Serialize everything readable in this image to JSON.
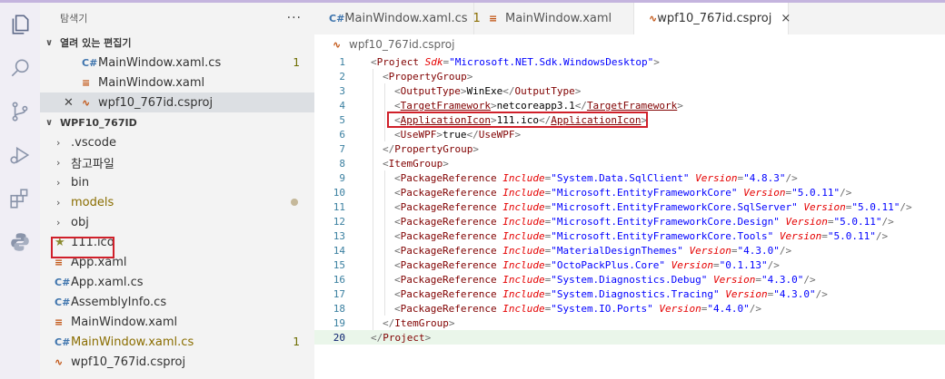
{
  "activity_bar": {
    "icons": [
      "files-icon",
      "search-icon",
      "source-control-icon",
      "run-debug-icon",
      "extensions-icon",
      "python-icon"
    ]
  },
  "sidebar": {
    "title": "탐색기",
    "more_label": "···",
    "open_editors": {
      "header": "열려 있는 편집기",
      "items": [
        {
          "name": "MainWindow.xaml.cs",
          "type": "cs",
          "badge": "1"
        },
        {
          "name": "MainWindow.xaml",
          "type": "xaml",
          "badge": ""
        },
        {
          "name": "wpf10_767id.csproj",
          "type": "csproj",
          "badge": "",
          "selected": true
        }
      ]
    },
    "project": {
      "header": "WPF10_767ID",
      "folders": [
        {
          "name": ".vscode",
          "dot": false
        },
        {
          "name": "참고파일",
          "dot": false
        },
        {
          "name": "bin",
          "dot": false
        },
        {
          "name": "models",
          "dot": true
        },
        {
          "name": "obj",
          "dot": false
        }
      ],
      "files": [
        {
          "name": "111.ico",
          "type": "ico",
          "badge": ""
        },
        {
          "name": "App.xaml",
          "type": "xaml",
          "badge": ""
        },
        {
          "name": "App.xaml.cs",
          "type": "cs",
          "badge": ""
        },
        {
          "name": "AssemblyInfo.cs",
          "type": "cs",
          "badge": ""
        },
        {
          "name": "MainWindow.xaml",
          "type": "xaml",
          "badge": ""
        },
        {
          "name": "MainWindow.xaml.cs",
          "type": "cs",
          "badge": "1"
        },
        {
          "name": "wpf10_767id.csproj",
          "type": "csproj",
          "badge": ""
        }
      ]
    }
  },
  "tabs": [
    {
      "label": "MainWindow.xaml.cs",
      "type": "cs",
      "badge": "1",
      "active": false
    },
    {
      "label": "MainWindow.xaml",
      "type": "xaml",
      "badge": "",
      "active": false
    },
    {
      "label": "wpf10_767id.csproj",
      "type": "csproj",
      "badge": "",
      "active": true,
      "close": "×"
    }
  ],
  "breadcrumb": "wpf10_767id.csproj",
  "code_lines": [
    {
      "n": "1",
      "indent": 0,
      "parts": [
        [
          "brk",
          "<"
        ],
        [
          "tag",
          "Project"
        ],
        [
          "txt",
          " "
        ],
        [
          "attr",
          "Sdk"
        ],
        [
          "brk",
          "="
        ],
        [
          "val",
          "\"Microsoft.NET.Sdk.WindowsDesktop\""
        ],
        [
          "brk",
          ">"
        ]
      ]
    },
    {
      "n": "2",
      "indent": 1,
      "parts": [
        [
          "brk",
          "<"
        ],
        [
          "tag",
          "PropertyGroup"
        ],
        [
          "brk",
          ">"
        ]
      ]
    },
    {
      "n": "3",
      "indent": 2,
      "parts": [
        [
          "brk",
          "<"
        ],
        [
          "tag",
          "OutputType"
        ],
        [
          "brk",
          ">"
        ],
        [
          "txt",
          "WinExe"
        ],
        [
          "brk",
          "</"
        ],
        [
          "tag",
          "OutputType"
        ],
        [
          "brk",
          ">"
        ]
      ]
    },
    {
      "n": "4",
      "indent": 2,
      "parts": [
        [
          "brk",
          "<"
        ],
        [
          "tagu",
          "TargetFramework"
        ],
        [
          "brk",
          ">"
        ],
        [
          "txt",
          "netcoreapp3.1"
        ],
        [
          "brk",
          "</"
        ],
        [
          "tagu",
          "TargetFramework"
        ],
        [
          "brk",
          ">"
        ]
      ]
    },
    {
      "n": "5",
      "indent": 2,
      "parts": [
        [
          "brk",
          "<"
        ],
        [
          "tagu",
          "ApplicationIcon"
        ],
        [
          "brk",
          ">"
        ],
        [
          "txt",
          "111.ico"
        ],
        [
          "brk",
          "</"
        ],
        [
          "tagu",
          "ApplicationIcon"
        ],
        [
          "brk",
          ">"
        ]
      ]
    },
    {
      "n": "6",
      "indent": 2,
      "parts": [
        [
          "brk",
          "<"
        ],
        [
          "tag",
          "UseWPF"
        ],
        [
          "brk",
          ">"
        ],
        [
          "txt",
          "true"
        ],
        [
          "brk",
          "</"
        ],
        [
          "tag",
          "UseWPF"
        ],
        [
          "brk",
          ">"
        ]
      ]
    },
    {
      "n": "7",
      "indent": 1,
      "parts": [
        [
          "brk",
          "</"
        ],
        [
          "tag",
          "PropertyGroup"
        ],
        [
          "brk",
          ">"
        ]
      ]
    },
    {
      "n": "8",
      "indent": 1,
      "parts": [
        [
          "brk",
          "<"
        ],
        [
          "tag",
          "ItemGroup"
        ],
        [
          "brk",
          ">"
        ]
      ]
    },
    {
      "n": "9",
      "indent": 2,
      "parts": [
        [
          "brk",
          "<"
        ],
        [
          "tag",
          "PackageReference"
        ],
        [
          "txt",
          " "
        ],
        [
          "attr",
          "Include"
        ],
        [
          "brk",
          "="
        ],
        [
          "val",
          "\"System.Data.SqlClient\""
        ],
        [
          "txt",
          " "
        ],
        [
          "attr",
          "Version"
        ],
        [
          "brk",
          "="
        ],
        [
          "val",
          "\"4.8.3\""
        ],
        [
          "brk",
          "/>"
        ]
      ]
    },
    {
      "n": "10",
      "indent": 2,
      "parts": [
        [
          "brk",
          "<"
        ],
        [
          "tag",
          "PackageReference"
        ],
        [
          "txt",
          " "
        ],
        [
          "attr",
          "Include"
        ],
        [
          "brk",
          "="
        ],
        [
          "val",
          "\"Microsoft.EntityFrameworkCore\""
        ],
        [
          "txt",
          " "
        ],
        [
          "attr",
          "Version"
        ],
        [
          "brk",
          "="
        ],
        [
          "val",
          "\"5.0.11\""
        ],
        [
          "brk",
          "/>"
        ]
      ]
    },
    {
      "n": "11",
      "indent": 2,
      "parts": [
        [
          "brk",
          "<"
        ],
        [
          "tag",
          "PackageReference"
        ],
        [
          "txt",
          " "
        ],
        [
          "attr",
          "Include"
        ],
        [
          "brk",
          "="
        ],
        [
          "val",
          "\"Microsoft.EntityFrameworkCore.SqlServer\""
        ],
        [
          "txt",
          " "
        ],
        [
          "attr",
          "Version"
        ],
        [
          "brk",
          "="
        ],
        [
          "val",
          "\"5.0.11\""
        ],
        [
          "brk",
          "/>"
        ]
      ]
    },
    {
      "n": "12",
      "indent": 2,
      "parts": [
        [
          "brk",
          "<"
        ],
        [
          "tag",
          "PackageReference"
        ],
        [
          "txt",
          " "
        ],
        [
          "attr",
          "Include"
        ],
        [
          "brk",
          "="
        ],
        [
          "val",
          "\"Microsoft.EntityFrameworkCore.Design\""
        ],
        [
          "txt",
          " "
        ],
        [
          "attr",
          "Version"
        ],
        [
          "brk",
          "="
        ],
        [
          "val",
          "\"5.0.11\""
        ],
        [
          "brk",
          "/>"
        ]
      ]
    },
    {
      "n": "13",
      "indent": 2,
      "parts": [
        [
          "brk",
          "<"
        ],
        [
          "tag",
          "PackageReference"
        ],
        [
          "txt",
          " "
        ],
        [
          "attr",
          "Include"
        ],
        [
          "brk",
          "="
        ],
        [
          "val",
          "\"Microsoft.EntityFrameworkCore.Tools\""
        ],
        [
          "txt",
          " "
        ],
        [
          "attr",
          "Version"
        ],
        [
          "brk",
          "="
        ],
        [
          "val",
          "\"5.0.11\""
        ],
        [
          "brk",
          "/>"
        ]
      ]
    },
    {
      "n": "14",
      "indent": 2,
      "parts": [
        [
          "brk",
          "<"
        ],
        [
          "tag",
          "PackageReference"
        ],
        [
          "txt",
          " "
        ],
        [
          "attr",
          "Include"
        ],
        [
          "brk",
          "="
        ],
        [
          "val",
          "\"MaterialDesignThemes\""
        ],
        [
          "txt",
          " "
        ],
        [
          "attr",
          "Version"
        ],
        [
          "brk",
          "="
        ],
        [
          "val",
          "\"4.3.0\""
        ],
        [
          "brk",
          "/>"
        ]
      ]
    },
    {
      "n": "15",
      "indent": 2,
      "parts": [
        [
          "brk",
          "<"
        ],
        [
          "tag",
          "PackageReference"
        ],
        [
          "txt",
          " "
        ],
        [
          "attr",
          "Include"
        ],
        [
          "brk",
          "="
        ],
        [
          "val",
          "\"OctoPackPlus.Core\""
        ],
        [
          "txt",
          " "
        ],
        [
          "attr",
          "Version"
        ],
        [
          "brk",
          "="
        ],
        [
          "val",
          "\"0.1.13\""
        ],
        [
          "brk",
          "/>"
        ]
      ]
    },
    {
      "n": "16",
      "indent": 2,
      "parts": [
        [
          "brk",
          "<"
        ],
        [
          "tag",
          "PackageReference"
        ],
        [
          "txt",
          " "
        ],
        [
          "attr",
          "Include"
        ],
        [
          "brk",
          "="
        ],
        [
          "val",
          "\"System.Diagnostics.Debug\""
        ],
        [
          "txt",
          " "
        ],
        [
          "attr",
          "Version"
        ],
        [
          "brk",
          "="
        ],
        [
          "val",
          "\"4.3.0\""
        ],
        [
          "brk",
          "/>"
        ]
      ]
    },
    {
      "n": "17",
      "indent": 2,
      "parts": [
        [
          "brk",
          "<"
        ],
        [
          "tag",
          "PackageReference"
        ],
        [
          "txt",
          " "
        ],
        [
          "attr",
          "Include"
        ],
        [
          "brk",
          "="
        ],
        [
          "val",
          "\"System.Diagnostics.Tracing\""
        ],
        [
          "txt",
          " "
        ],
        [
          "attr",
          "Version"
        ],
        [
          "brk",
          "="
        ],
        [
          "val",
          "\"4.3.0\""
        ],
        [
          "brk",
          "/>"
        ]
      ]
    },
    {
      "n": "18",
      "indent": 2,
      "parts": [
        [
          "brk",
          "<"
        ],
        [
          "tag",
          "PackageReference"
        ],
        [
          "txt",
          " "
        ],
        [
          "attr",
          "Include"
        ],
        [
          "brk",
          "="
        ],
        [
          "val",
          "\"System.IO.Ports\""
        ],
        [
          "txt",
          " "
        ],
        [
          "attr",
          "Version"
        ],
        [
          "brk",
          "="
        ],
        [
          "val",
          "\"4.4.0\""
        ],
        [
          "brk",
          "/>"
        ]
      ]
    },
    {
      "n": "19",
      "indent": 1,
      "parts": [
        [
          "brk",
          "</"
        ],
        [
          "tag",
          "ItemGroup"
        ],
        [
          "brk",
          ">"
        ]
      ]
    },
    {
      "n": "20",
      "indent": 0,
      "current": true,
      "parts": [
        [
          "brk",
          "</"
        ],
        [
          "tag",
          "Project"
        ],
        [
          "brk",
          ">"
        ]
      ]
    }
  ],
  "colors": {
    "accent_border": "#c4b4de",
    "highlight_box": "#d0202a",
    "current_line": "#eaf6ea"
  }
}
